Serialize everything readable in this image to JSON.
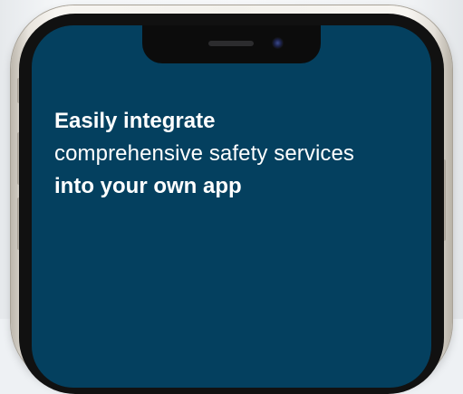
{
  "headline": {
    "line1": "Easily integrate",
    "line2": "comprehensive safety services",
    "line3": "into your own app"
  },
  "colors": {
    "screen_background": "#04405f",
    "text": "#ffffff",
    "frame": "#f3f1ec",
    "notch": "#0c0c0c"
  },
  "icons": {
    "speaker": "speaker-grille-icon",
    "camera": "front-camera-icon"
  }
}
